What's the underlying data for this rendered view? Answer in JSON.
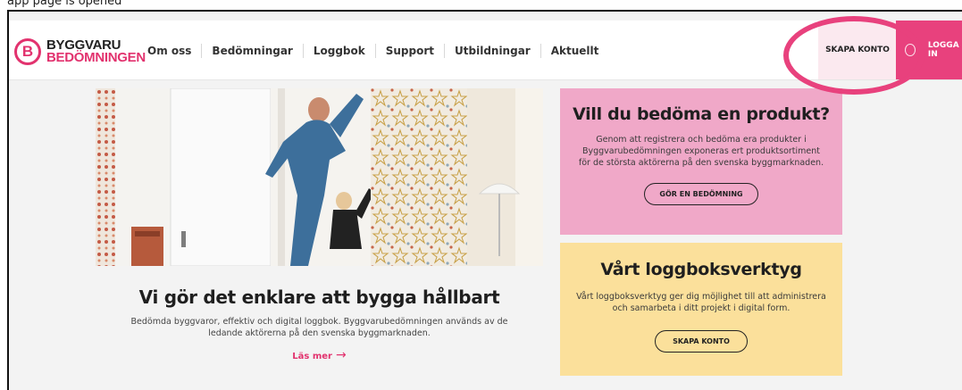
{
  "caption": "app page is opened",
  "header": {
    "logo": {
      "letter": "B",
      "line1": "BYGGVARU",
      "line2": "BEDÖMNINGEN"
    },
    "nav": [
      "Om oss",
      "Bedömningar",
      "Loggbok",
      "Support",
      "Utbildningar",
      "Aktuellt"
    ],
    "skapa_konto": "SKAPA KONTO",
    "logga_in": "LOGGA IN"
  },
  "hero": {
    "title": "Vi gör det enklare att bygga hållbart",
    "description": "Bedömda byggvaror, effektiv och digital loggbok. Byggvarubedömningen används av de ledande aktörerna på den svenska byggmarknaden.",
    "link": "Läs mer",
    "link_arrow": "→"
  },
  "card_product": {
    "title": "Vill du bedöma en produkt?",
    "text": "Genom att registrera och bedöma era produkter i Byggvarubedömningen exponeras ert produktsortiment för de största aktörerna på den svenska byggmarknaden.",
    "button": "GÖR EN BEDÖMNING"
  },
  "card_logbook": {
    "title": "Vårt loggboksverktyg",
    "text": "Vårt loggboksverktyg ger dig möjlighet till att administrera och samarbeta i ditt projekt i digital form.",
    "button": "SKAPA KONTO"
  },
  "colors": {
    "brand_pink": "#e2326e",
    "card_pink": "#f0a8c8",
    "card_yellow": "#fbe09b",
    "highlight": "#e8417d"
  }
}
